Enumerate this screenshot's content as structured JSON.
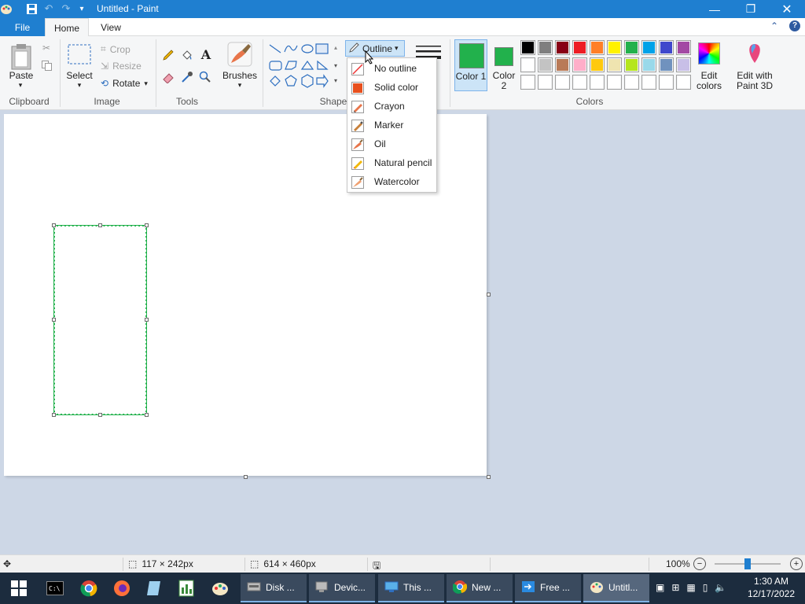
{
  "app": {
    "title": "Untitled - Paint"
  },
  "tabs": {
    "file": "File",
    "home": "Home",
    "view": "View"
  },
  "ribbon": {
    "clipboard": {
      "paste": "Paste",
      "group": "Clipboard"
    },
    "image": {
      "select": "Select",
      "crop": "Crop",
      "resize": "Resize",
      "rotate": "Rotate",
      "group": "Image"
    },
    "tools": {
      "group": "Tools"
    },
    "brushes": {
      "label": "Brushes"
    },
    "shapes": {
      "group": "Shape",
      "outline": "Outline"
    },
    "colors": {
      "color1": "Color 1",
      "color2": "Color 2",
      "group": "Colors",
      "edit_colors": "Edit colors",
      "edit_paint3d": "Edit with Paint 3D",
      "color1_value": "#22b14c",
      "color2_value": "#22b14c",
      "row1": [
        "#000000",
        "#7f7f7f",
        "#880015",
        "#ed1c24",
        "#ff7f27",
        "#fff200",
        "#22b14c",
        "#00a2e8",
        "#3f48cc",
        "#a349a4"
      ],
      "row2": [
        "#ffffff",
        "#c3c3c3",
        "#b97a57",
        "#ffaec9",
        "#ffc90e",
        "#efe4b0",
        "#b5e61d",
        "#99d9ea",
        "#7092be",
        "#c8bfe7"
      ],
      "row3": [
        "#ffffff",
        "#ffffff",
        "#ffffff",
        "#ffffff",
        "#ffffff",
        "#ffffff",
        "#ffffff",
        "#ffffff",
        "#ffffff",
        "#ffffff"
      ]
    }
  },
  "outline_menu": {
    "items": [
      {
        "label": "No outline",
        "icon": "no-outline-icon"
      },
      {
        "label": "Solid color",
        "icon": "solid-color-icon"
      },
      {
        "label": "Crayon",
        "icon": "crayon-icon"
      },
      {
        "label": "Marker",
        "icon": "marker-icon"
      },
      {
        "label": "Oil",
        "icon": "oil-icon"
      },
      {
        "label": "Natural pencil",
        "icon": "natural-pencil-icon"
      },
      {
        "label": "Watercolor",
        "icon": "watercolor-icon"
      }
    ]
  },
  "status": {
    "selection_size": "117 × 242px",
    "canvas_size": "614 × 460px",
    "zoom": "100%",
    "zoom_level": 0.5
  },
  "taskbar": {
    "tasks": [
      {
        "label": "Disk ...",
        "icon": "disk-icon"
      },
      {
        "label": "Devic...",
        "icon": "device-icon"
      },
      {
        "label": "This ...",
        "icon": "this-pc-icon"
      },
      {
        "label": "New ...",
        "icon": "chrome-icon"
      },
      {
        "label": "Free ...",
        "icon": "free-icon"
      },
      {
        "label": "Untitl...",
        "icon": "paint-icon"
      }
    ],
    "time": "1:30 AM",
    "date": "12/17/2022"
  }
}
